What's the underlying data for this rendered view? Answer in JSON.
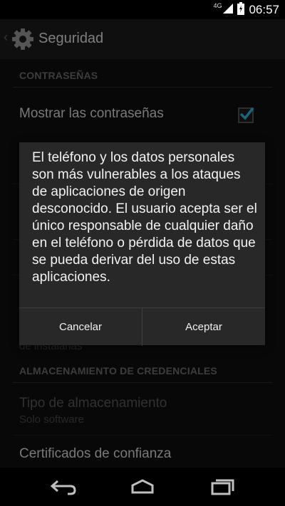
{
  "status_bar": {
    "network_label": "4G",
    "time": "06:57"
  },
  "action_bar": {
    "title": "Seguridad",
    "icon": "gear-icon"
  },
  "settings": {
    "passwords_category": "CONTRASEÑAS",
    "show_passwords_label": "Mostrar las contraseñas",
    "show_passwords_checked": true,
    "partial_visible_sub": "de instalarlas",
    "credentials_category": "ALMACENAMIENTO DE CREDENCIALES",
    "storage_type_title": "Tipo de almacenamiento",
    "storage_type_value": "Solo software",
    "trusted_certs_title": "Certificados de confianza"
  },
  "dialog": {
    "message": "El teléfono y los datos personales son más vulnerables a los ataques de aplicaciones de origen desconocido. El usuario acepta ser el único responsable de cualquier daño en el teléfono o pérdida de datos que se pueda derivar del uso de estas aplicaciones.",
    "cancel_label": "Cancelar",
    "accept_label": "Aceptar"
  },
  "colors": {
    "accent": "#33b5e5",
    "background": "#0f0f0f",
    "dialog": "#282828"
  }
}
